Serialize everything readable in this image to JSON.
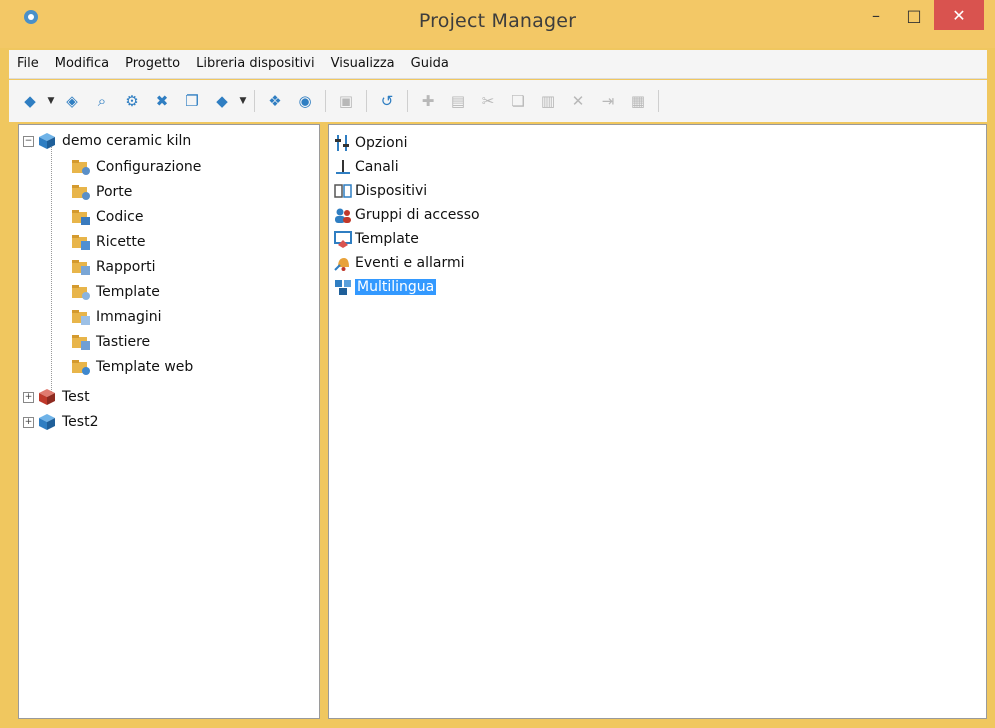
{
  "window": {
    "title": "Project Manager",
    "minimize_glyph": "–",
    "maximize_glyph": "□",
    "close_glyph": "✕"
  },
  "menu": [
    "File",
    "Modifica",
    "Progetto",
    "Libreria dispositivi",
    "Visualizza",
    "Guida"
  ],
  "toolbar": {
    "icons": [
      "cube-icon",
      "dropdown-arrow-icon",
      "open-project-icon",
      "find-icon",
      "project-settings-icon",
      "delete-project-icon",
      "project-copy-icon",
      "import-project-icon",
      "dropdown-arrow-icon",
      "compile-icon",
      "run-icon",
      "disabled-icon",
      "refresh-icon",
      "new-icon",
      "open-folder-icon",
      "cut-icon",
      "copy-icon",
      "paste-icon",
      "delete-icon",
      "rename-icon",
      "properties-icon"
    ]
  },
  "tree": {
    "root": {
      "label": "demo ceramic kiln",
      "expander": "−",
      "children": [
        "Configurazione",
        "Porte",
        "Codice",
        "Ricette",
        "Rapporti",
        "Template",
        "Immagini",
        "Tastiere",
        "Template web"
      ]
    },
    "others": [
      {
        "label": "Test",
        "expander": "+",
        "color": "#c0392b"
      },
      {
        "label": "Test2",
        "expander": "+",
        "color": "#2f7ec2"
      }
    ]
  },
  "list": {
    "items": [
      "Opzioni",
      "Canali",
      "Dispositivi",
      "Gruppi di accesso",
      "Template",
      "Eventi e allarmi",
      "Multilingua"
    ],
    "selected": "Multilingua"
  },
  "colors": {
    "title_bar": "#f3c866",
    "close_button": "#d9534f",
    "selection": "#3399ff",
    "folder": "#e8b54a"
  }
}
